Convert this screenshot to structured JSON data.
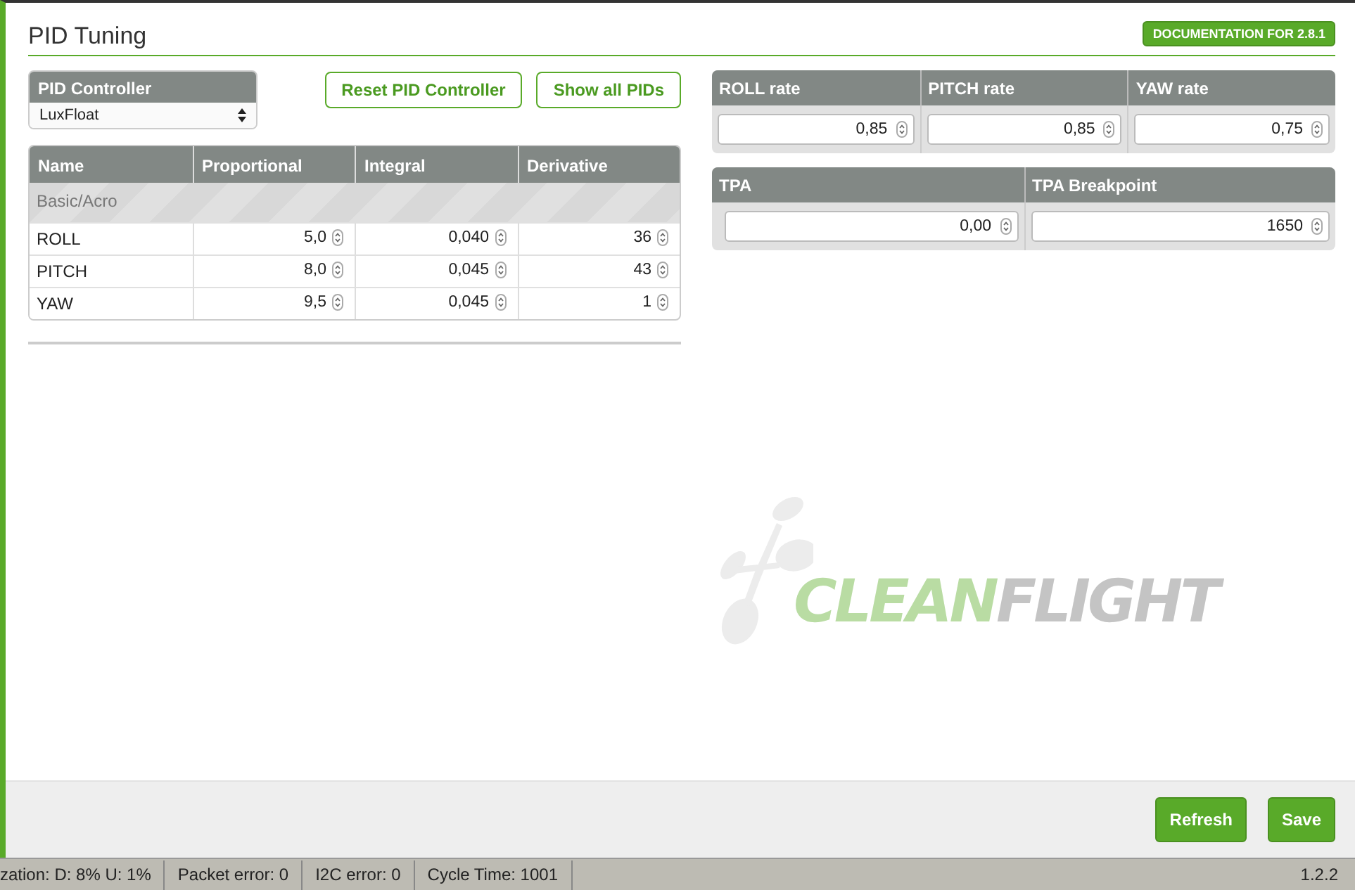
{
  "page": {
    "title": "PID Tuning",
    "doc_button": "DOCUMENTATION FOR 2.8.1"
  },
  "controller": {
    "label": "PID Controller",
    "value": "LuxFloat"
  },
  "buttons": [
    "Reset PID Controller",
    "Show all PIDs"
  ],
  "pid_table": {
    "columns": [
      "Name",
      "Proportional",
      "Integral",
      "Derivative"
    ],
    "group": "Basic/Acro",
    "rows": [
      {
        "name": "ROLL",
        "values": [
          "5,0",
          "0,040",
          "36"
        ]
      },
      {
        "name": "PITCH",
        "values": [
          "8,0",
          "0,045",
          "43"
        ]
      },
      {
        "name": "YAW",
        "values": [
          "9,5",
          "0,045",
          "1"
        ]
      }
    ]
  },
  "rates": [
    {
      "label": "ROLL rate",
      "value": "0,85"
    },
    {
      "label": "PITCH rate",
      "value": "0,85"
    },
    {
      "label": "YAW rate",
      "value": "0,75"
    }
  ],
  "tpa": [
    {
      "label": "TPA",
      "value": "0,00"
    },
    {
      "label": "TPA Breakpoint",
      "value": "1650"
    }
  ],
  "logo": {
    "part_1": "CLEAN",
    "part_2": "FLIGHT"
  },
  "actions": [
    "Refresh",
    "Save"
  ],
  "status_bar": {
    "items": [
      "zation: D: 8% U: 1%",
      "Packet error: 0",
      "I2C error: 0",
      "Cycle Time: 1001"
    ],
    "version": "1.2.2"
  }
}
